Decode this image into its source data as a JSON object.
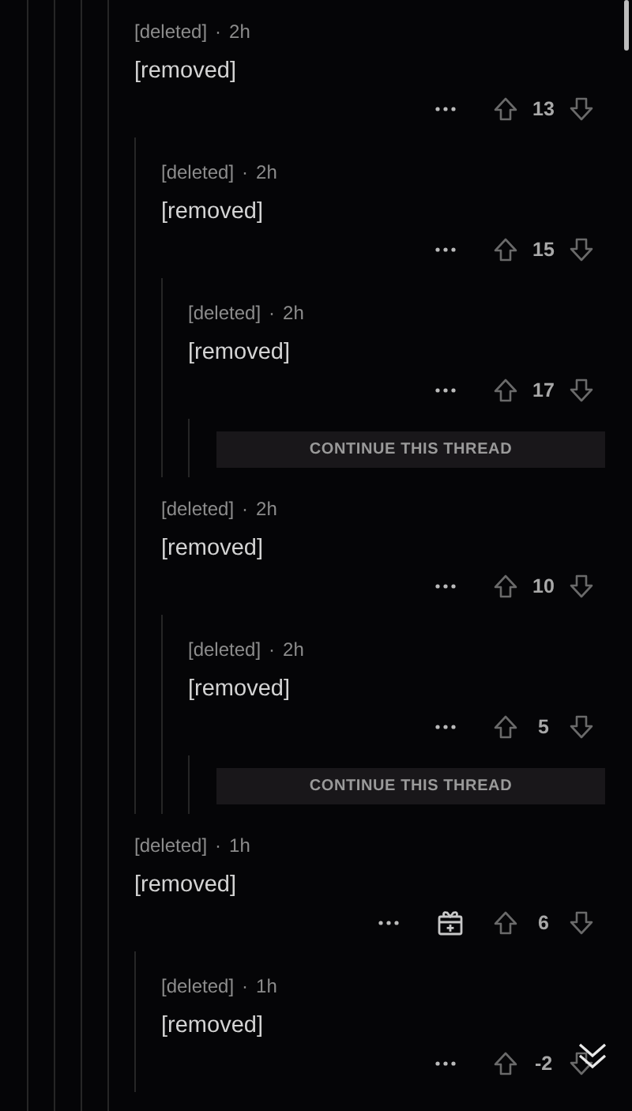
{
  "comments": [
    {
      "kind": "continuation",
      "children": [
        {
          "kind": "comment",
          "author": "[deleted]",
          "separator": "·",
          "time": "2h",
          "body": "[removed]",
          "score": "13",
          "children": [
            {
              "kind": "comment",
              "author": "[deleted]",
              "separator": "·",
              "time": "2h",
              "body": "[removed]",
              "score": "15",
              "children": [
                {
                  "kind": "comment",
                  "author": "[deleted]",
                  "separator": "·",
                  "time": "2h",
                  "body": "[removed]",
                  "score": "17",
                  "more_replies": "CONTINUE THIS THREAD"
                }
              ]
            },
            {
              "kind": "comment",
              "author": "[deleted]",
              "separator": "·",
              "time": "2h",
              "body": "[removed]",
              "score": "10",
              "children": [
                {
                  "kind": "comment",
                  "author": "[deleted]",
                  "separator": "·",
                  "time": "2h",
                  "body": "[removed]",
                  "score": "5",
                  "more_replies": "CONTINUE THIS THREAD"
                }
              ]
            }
          ]
        }
      ]
    },
    {
      "kind": "comment",
      "author": "[deleted]",
      "separator": "·",
      "time": "1h",
      "body": "[removed]",
      "score": "6",
      "award": true,
      "children": [
        {
          "kind": "comment",
          "author": "[deleted]",
          "separator": "·",
          "time": "1h",
          "body": "[removed]",
          "score": "-2"
        }
      ]
    }
  ]
}
